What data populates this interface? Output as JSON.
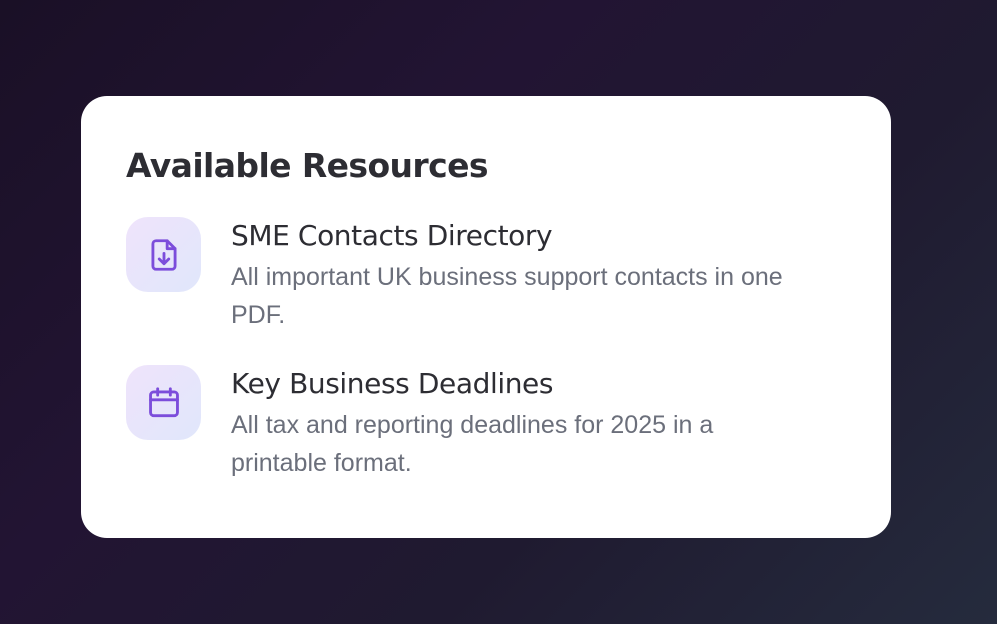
{
  "card": {
    "title": "Available Resources",
    "resources": [
      {
        "icon": "file-download-icon",
        "title": "SME Contacts Directory",
        "description": "All important UK business support contacts in one PDF."
      },
      {
        "icon": "calendar-icon",
        "title": "Key Business Deadlines",
        "description": "All tax and reporting deadlines for 2025 in a printable format."
      }
    ]
  },
  "colors": {
    "icon_accent": "#7c4ddb",
    "title_text": "#2d2d33",
    "description_text": "#6b6f7b"
  }
}
